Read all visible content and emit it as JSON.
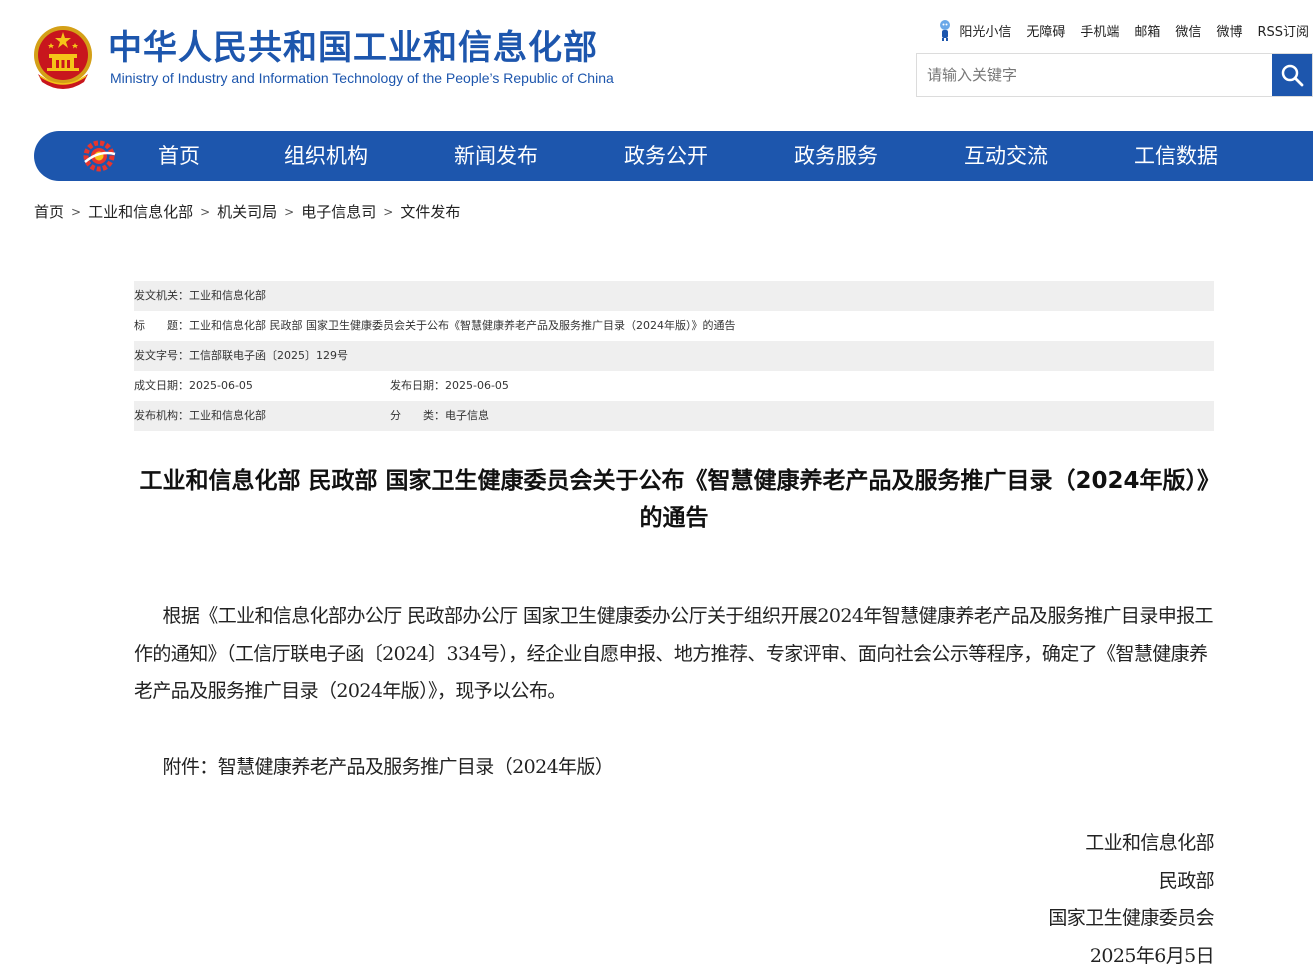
{
  "header": {
    "title_cn": "中华人民共和国工业和信息化部",
    "title_en": "Ministry of Industry and Information Technology of the People’s Republic of China",
    "toplinks": [
      "阳光小信",
      "无障碍",
      "手机端",
      "邮箱",
      "微信",
      "微博",
      "RSS订阅"
    ],
    "search": {
      "placeholder": "请输入关键字",
      "value": ""
    },
    "emblem_icon": "national-emblem-icon",
    "accent_color": "#1d56ad"
  },
  "nav": {
    "items": [
      "首页",
      "组织机构",
      "新闻发布",
      "政务公开",
      "政务服务",
      "互动交流",
      "工信数据"
    ]
  },
  "breadcrumb": [
    "首页",
    "工业和信息化部",
    "机关司局",
    "电子信息司",
    "文件发布"
  ],
  "meta": {
    "issuer_label": "发文机关：",
    "issuer": "工业和信息化部",
    "title_label": "标　　题：",
    "title": "工业和信息化部 民政部 国家卫生健康委员会关于公布《智慧健康养老产品及服务推广目录（2024年版）》的通告",
    "doc_no_label": "发文字号：",
    "doc_no": "工信部联电子函〔2025〕129号",
    "created_label": "成文日期：",
    "created": "2025-06-05",
    "published_label": "发布日期：",
    "published": "2025-06-05",
    "publisher_label": "发布机构：",
    "publisher": "工业和信息化部",
    "category_label": "分　　类：",
    "category": "电子信息"
  },
  "article": {
    "title": "工业和信息化部 民政部 国家卫生健康委员会关于公布《智慧健康养老产品及服务推广目录（2024年版）》的通告",
    "body": "根据《工业和信息化部办公厅 民政部办公厅 国家卫生健康委办公厅关于组织开展2024年智慧健康养老产品及服务推广目录申报工作的通知》（工信厅联电子函〔2024〕334号），经企业自愿申报、地方推荐、专家评审、面向社会公示等程序，确定了《智慧健康养老产品及服务推广目录（2024年版）》，现予以公布。",
    "attachment": "附件：智慧健康养老产品及服务推广目录（2024年版）",
    "signatures": [
      "工业和信息化部",
      "民政部",
      "国家卫生健康委员会",
      "2025年6月5日"
    ]
  }
}
